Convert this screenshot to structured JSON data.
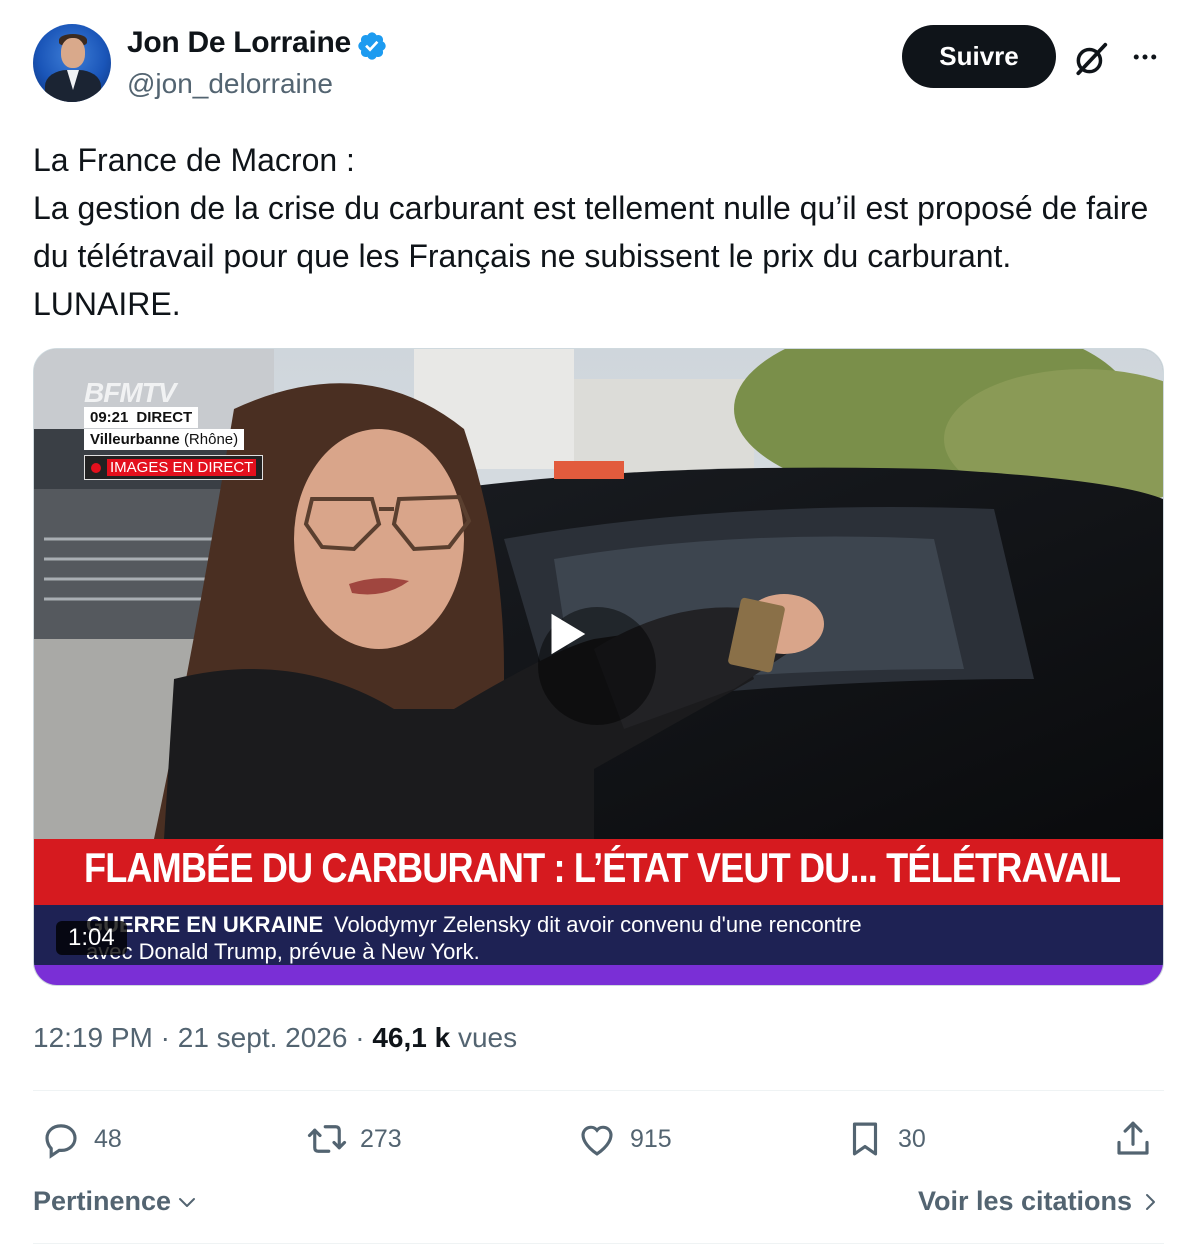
{
  "author": {
    "name": "Jon De Lorraine",
    "handle": "@jon_delorraine",
    "verified": true
  },
  "header": {
    "follow_label": "Suivre",
    "icons": [
      "grok-icon",
      "more-icon"
    ]
  },
  "tweet": {
    "text": "La France de Macron :\nLa gestion de la crise du carburant est tellement nulle qu’il est proposé de faire du télétravail pour que les Français ne subissent le prix du carburant. LUNAIRE."
  },
  "media": {
    "duration": "1:04",
    "overlay": {
      "logo": "BFMTV",
      "time": "09:21",
      "direct": "DIRECT",
      "location_city": "Villeurbanne",
      "location_region": "(Rhône)",
      "live_label": "IMAGES EN DIRECT",
      "headline": "FLAMBÉE DU CARBURANT : L’ÉTAT VEUT DU... TÉLÉTRAVAIL",
      "ticker_label": "GUERRE EN UKRAINE",
      "ticker_text": "Volodymyr Zelensky dit avoir convenu d'une rencontre",
      "ticker_text2": "avec Donald Trump, prévue à New York."
    }
  },
  "meta": {
    "time": "12:19 PM",
    "separator": "·",
    "date": "21 sept. 2026",
    "views_count": "46,1 k",
    "views_label": "vues"
  },
  "actions": {
    "replies": "48",
    "reposts": "273",
    "likes": "915",
    "bookmarks": "30"
  },
  "footer": {
    "sort_label": "Pertinence",
    "quotes_label": "Voir les citations"
  },
  "colors": {
    "text": "#0f1419",
    "secondary": "#536471",
    "verified": "#1d9bf0",
    "headline_red": "#d61a1f",
    "ticker_blue": "#1e2254"
  }
}
